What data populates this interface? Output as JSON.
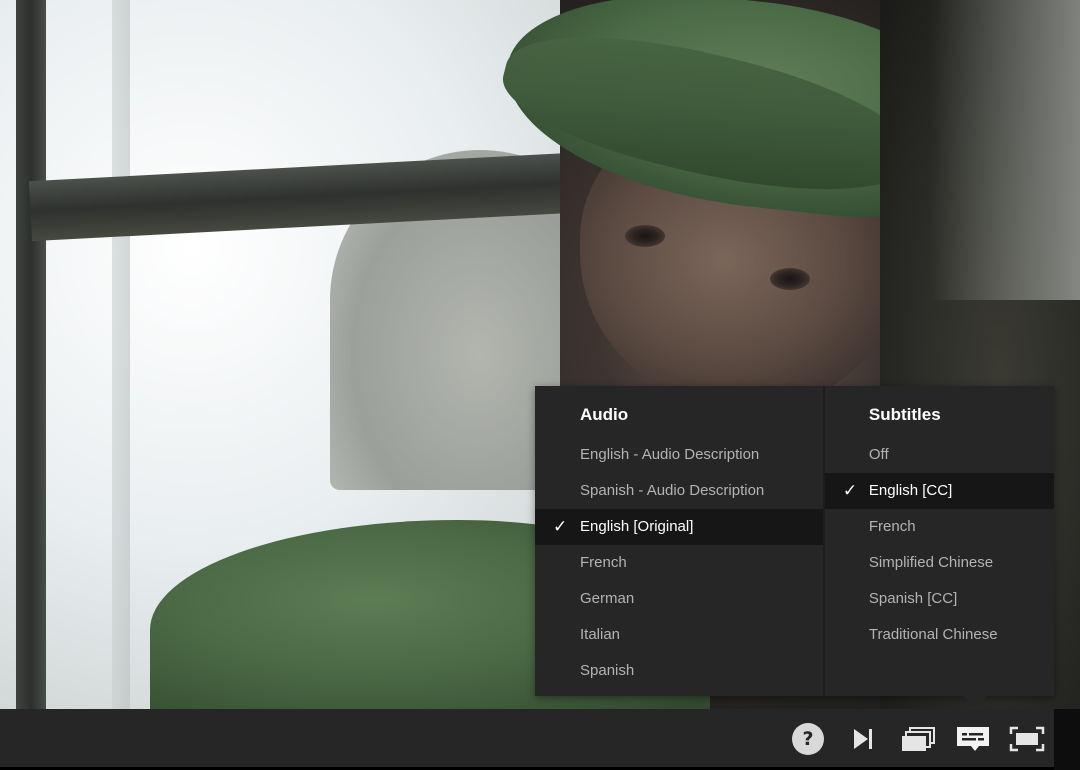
{
  "audio": {
    "title": "Audio",
    "options": [
      {
        "label": "English - Audio Description",
        "selected": false
      },
      {
        "label": "Spanish - Audio Description",
        "selected": false
      },
      {
        "label": "English [Original]",
        "selected": true
      },
      {
        "label": "French",
        "selected": false
      },
      {
        "label": "German",
        "selected": false
      },
      {
        "label": "Italian",
        "selected": false
      },
      {
        "label": "Spanish",
        "selected": false
      }
    ]
  },
  "subtitles": {
    "title": "Subtitles",
    "options": [
      {
        "label": "Off",
        "selected": false
      },
      {
        "label": "English [CC]",
        "selected": true
      },
      {
        "label": "French",
        "selected": false
      },
      {
        "label": "Simplified Chinese",
        "selected": false
      },
      {
        "label": "Spanish [CC]",
        "selected": false
      },
      {
        "label": "Traditional Chinese",
        "selected": false
      }
    ]
  },
  "check_glyph": "✓",
  "controls": {
    "help_label": "?",
    "icons": [
      "help-icon",
      "next-episode-icon",
      "episodes-icon",
      "subtitles-audio-icon",
      "fullscreen-icon"
    ]
  },
  "colors": {
    "menu_bg": "#262626",
    "selected_bg": "#161616",
    "text_default": "#b3b3b3",
    "text_selected": "#ffffff"
  }
}
